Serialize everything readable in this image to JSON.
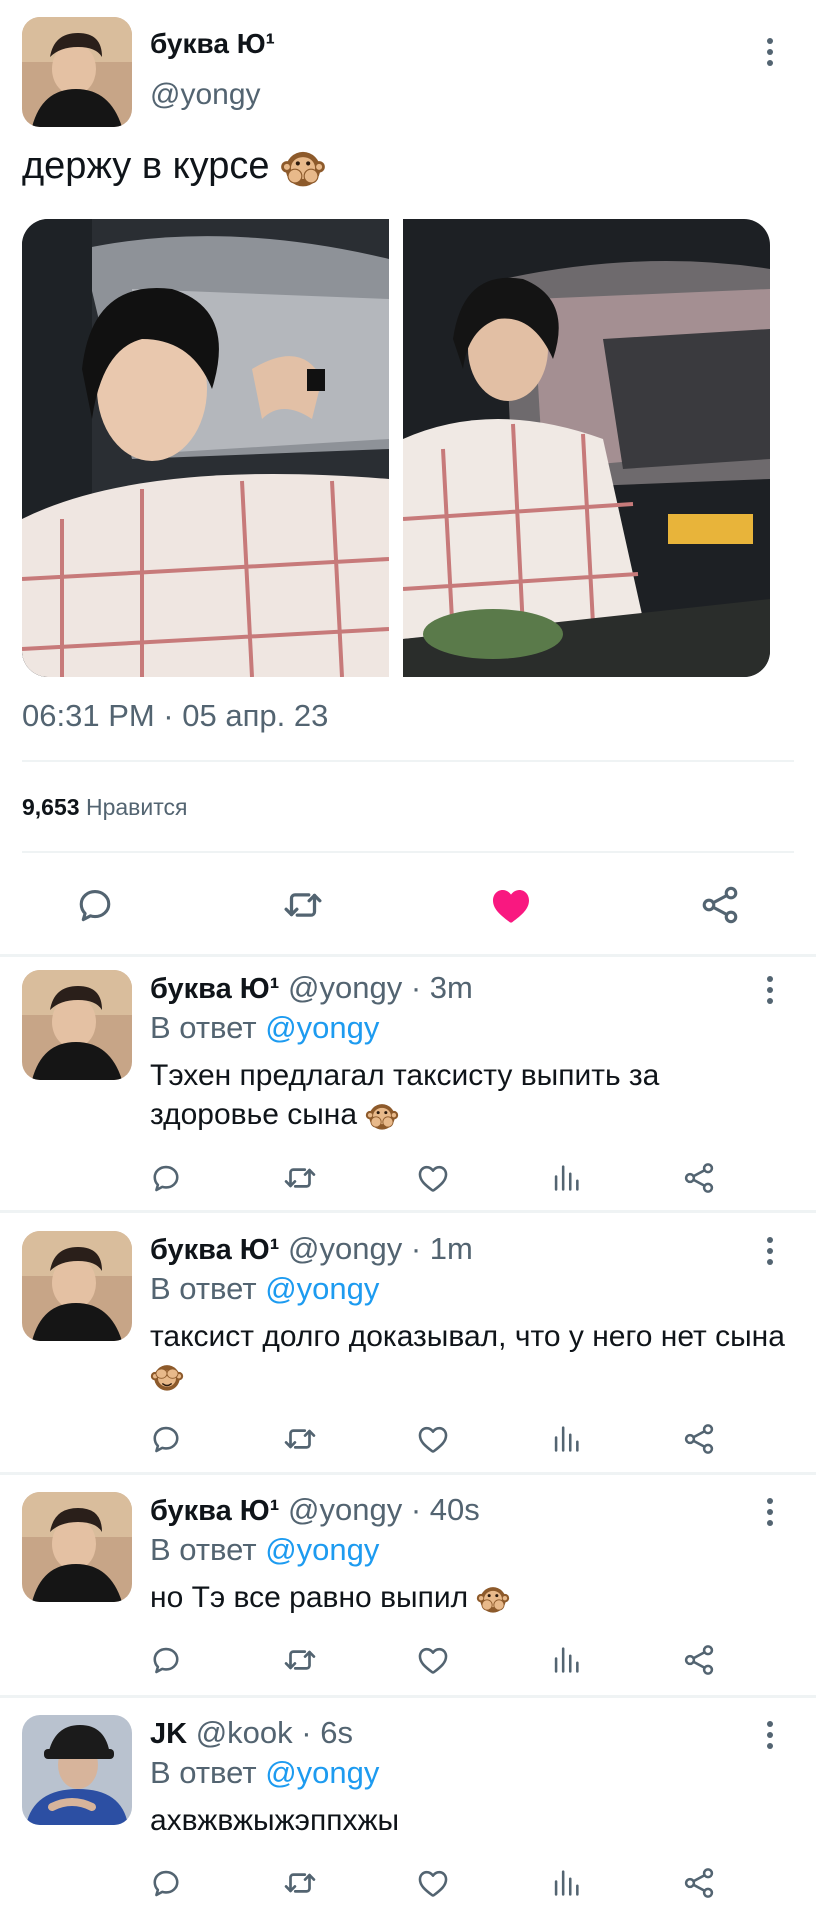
{
  "main_tweet": {
    "author_name": "буква Ю¹",
    "handle": "@yongy",
    "text": "держу в курсе",
    "text_emoji": "🙊",
    "timestamp": "06:31 PM · 05 апр. 23",
    "likes_count": "9,653",
    "likes_label": "Нравится",
    "liked": true,
    "icons": [
      "reply-icon",
      "retweet-icon",
      "heart-filled-icon",
      "share-icon"
    ],
    "like_color": "#f91880"
  },
  "replies": [
    {
      "author_name": "буква Ю¹",
      "handle": "@yongy",
      "time": "3m",
      "reply_prefix": "В ответ",
      "reply_to": "@yongy",
      "text": "Тэхен предлагал таксисту выпить  за здоровье сына",
      "emoji": "🙊"
    },
    {
      "author_name": "буква Ю¹",
      "handle": "@yongy",
      "time": "1m",
      "reply_prefix": "В ответ",
      "reply_to": "@yongy",
      "text": "таксист долго доказывал,  что у него  нет сына",
      "emoji": "🙈"
    },
    {
      "author_name": "буква Ю¹",
      "handle": "@yongy",
      "time": "40s",
      "reply_prefix": "В ответ",
      "reply_to": "@yongy",
      "text": "но Тэ все равно  выпил",
      "emoji": "🙊"
    },
    {
      "author_name": "JK",
      "handle": "@kook",
      "time": "6s",
      "reply_prefix": "В ответ",
      "reply_to": "@yongy",
      "text": "ахвжвжыжэппхжы",
      "emoji": ""
    }
  ],
  "colors": {
    "text_primary": "#0f1419",
    "text_secondary": "#536471",
    "mention": "#1d9bf0",
    "divider": "#eff3f4"
  }
}
